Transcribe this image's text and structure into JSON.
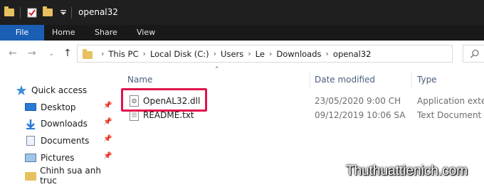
{
  "window": {
    "title": "openal32"
  },
  "ribbon": {
    "tabs": [
      "File",
      "Home",
      "Share",
      "View"
    ]
  },
  "address": {
    "crumbs": [
      "This PC",
      "Local Disk (C:)",
      "Users",
      "Le",
      "Downloads",
      "openal32"
    ]
  },
  "nav_pane": {
    "quick_access": "Quick access",
    "items": [
      {
        "label": "Desktop",
        "icon": "desktop-icon",
        "pinned": true
      },
      {
        "label": "Downloads",
        "icon": "download-icon",
        "pinned": true
      },
      {
        "label": "Documents",
        "icon": "documents-icon",
        "pinned": true
      },
      {
        "label": "Pictures",
        "icon": "pictures-icon",
        "pinned": true
      },
      {
        "label": "Chinh sua anh truc",
        "icon": "folder-icon",
        "pinned": false
      }
    ]
  },
  "file_list": {
    "columns": {
      "name": "Name",
      "date": "Date modified",
      "type": "Type"
    },
    "rows": [
      {
        "name": "OpenAL32.dll",
        "date": "23/05/2020 9:00 CH",
        "type": "Application exten",
        "icon": "dll-file-icon"
      },
      {
        "name": "README.txt",
        "date": "09/12/2019 10:06 SA",
        "type": "Text Document",
        "icon": "text-file-icon"
      }
    ]
  },
  "watermark": "Thuthuattienich.com",
  "colors": {
    "highlight": "#e0144c",
    "file_tab": "#1a5fb4",
    "titlebar": "#1f1f1f"
  }
}
